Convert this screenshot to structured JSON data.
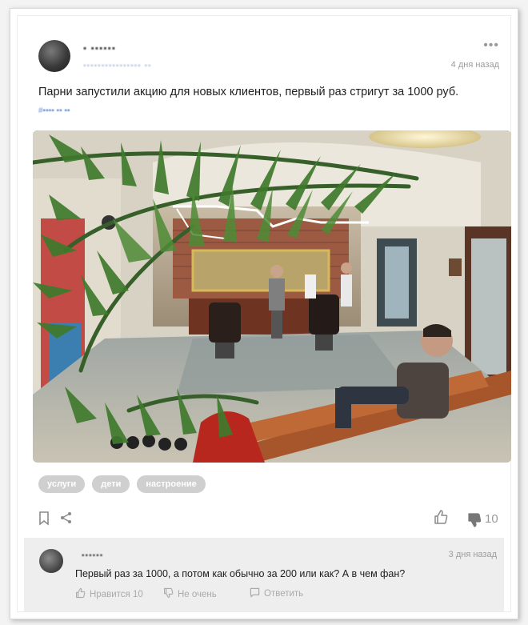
{
  "post": {
    "author": "▪ ▪▪▪▪▪▪",
    "subline": "▪▪▪▪▪▪▪▪▪▪▪▪▪▪▪▪ ▪▪",
    "date": "4 дня назад",
    "more_label": "•••",
    "text": "Парни запустили акцию для новых клиентов, первый раз стригут за 1000 руб.",
    "hashtag": "#▪▪▪▪ ▪▪ ▪▪",
    "tags": [
      "услуги",
      "дети",
      "настроение"
    ],
    "dislike_count": "10"
  },
  "comment": {
    "author": "▪▪▪▪▪▪",
    "date": "3 дня назад",
    "text": "Первый раз за 1000, а потом как обычно за 200 или как? А в чем фан?",
    "like_label": "Нравится 10",
    "dislike_label": "Не очень",
    "reply_label": "Ответить"
  },
  "icons": {
    "bookmark": "bookmark-icon",
    "share": "share-icon",
    "like": "thumbs-up-icon",
    "dislike": "thumbs-down-icon",
    "reply": "comment-icon"
  },
  "colors": {
    "tag_bg": "#cfcfcf",
    "comment_bg": "#eeeeee",
    "muted_text": "#9c9c9c"
  }
}
